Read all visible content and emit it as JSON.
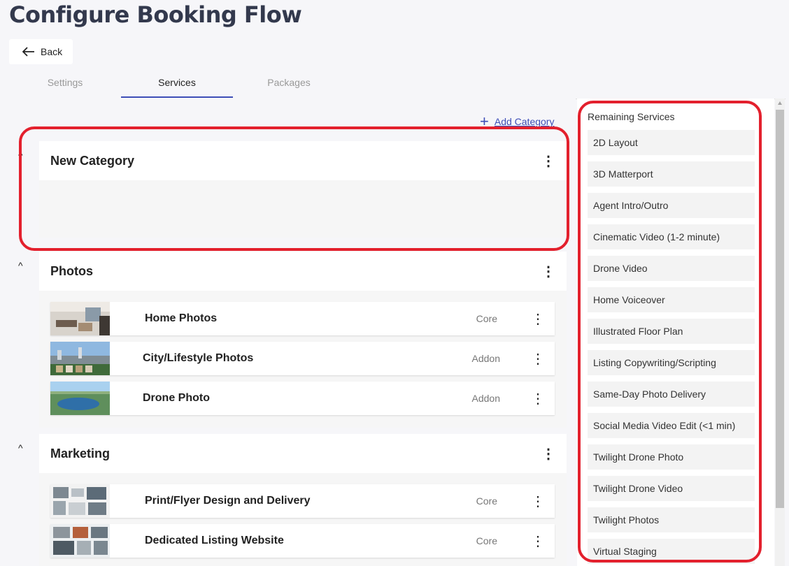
{
  "page": {
    "title": "Configure Booking Flow",
    "back_label": "Back"
  },
  "tabs": [
    {
      "label": "Settings",
      "active": false
    },
    {
      "label": "Services",
      "active": true
    },
    {
      "label": "Packages",
      "active": false
    }
  ],
  "add_category_label": "Add Category",
  "categories": [
    {
      "name": "New Category",
      "services": []
    },
    {
      "name": "Photos",
      "services": [
        {
          "name": "Home Photos",
          "tag": "Core",
          "thumb": "interior"
        },
        {
          "name": "City/Lifestyle Photos",
          "tag": "Addon",
          "thumb": "city"
        },
        {
          "name": "Drone Photo",
          "tag": "Addon",
          "thumb": "aerial"
        }
      ]
    },
    {
      "name": "Marketing",
      "services": [
        {
          "name": "Print/Flyer Design and Delivery",
          "tag": "Core",
          "thumb": "flyer"
        },
        {
          "name": "Dedicated Listing Website",
          "tag": "Core",
          "thumb": "website"
        }
      ]
    }
  ],
  "remaining_services": {
    "title": "Remaining Services",
    "items": [
      "2D Layout",
      "3D Matterport",
      "Agent Intro/Outro",
      "Cinematic Video (1-2 minute)",
      "Drone Video",
      "Home Voiceover",
      "Illustrated Floor Plan",
      "Listing Copywriting/Scripting",
      "Same-Day Photo Delivery",
      "Social Media Video Edit (<1 min)",
      "Twilight Drone Photo",
      "Twilight Drone Video",
      "Twilight Photos",
      "Virtual Staging"
    ]
  },
  "colors": {
    "accent": "#3d4db7",
    "highlight": "#e3202d",
    "title": "#33394d"
  }
}
